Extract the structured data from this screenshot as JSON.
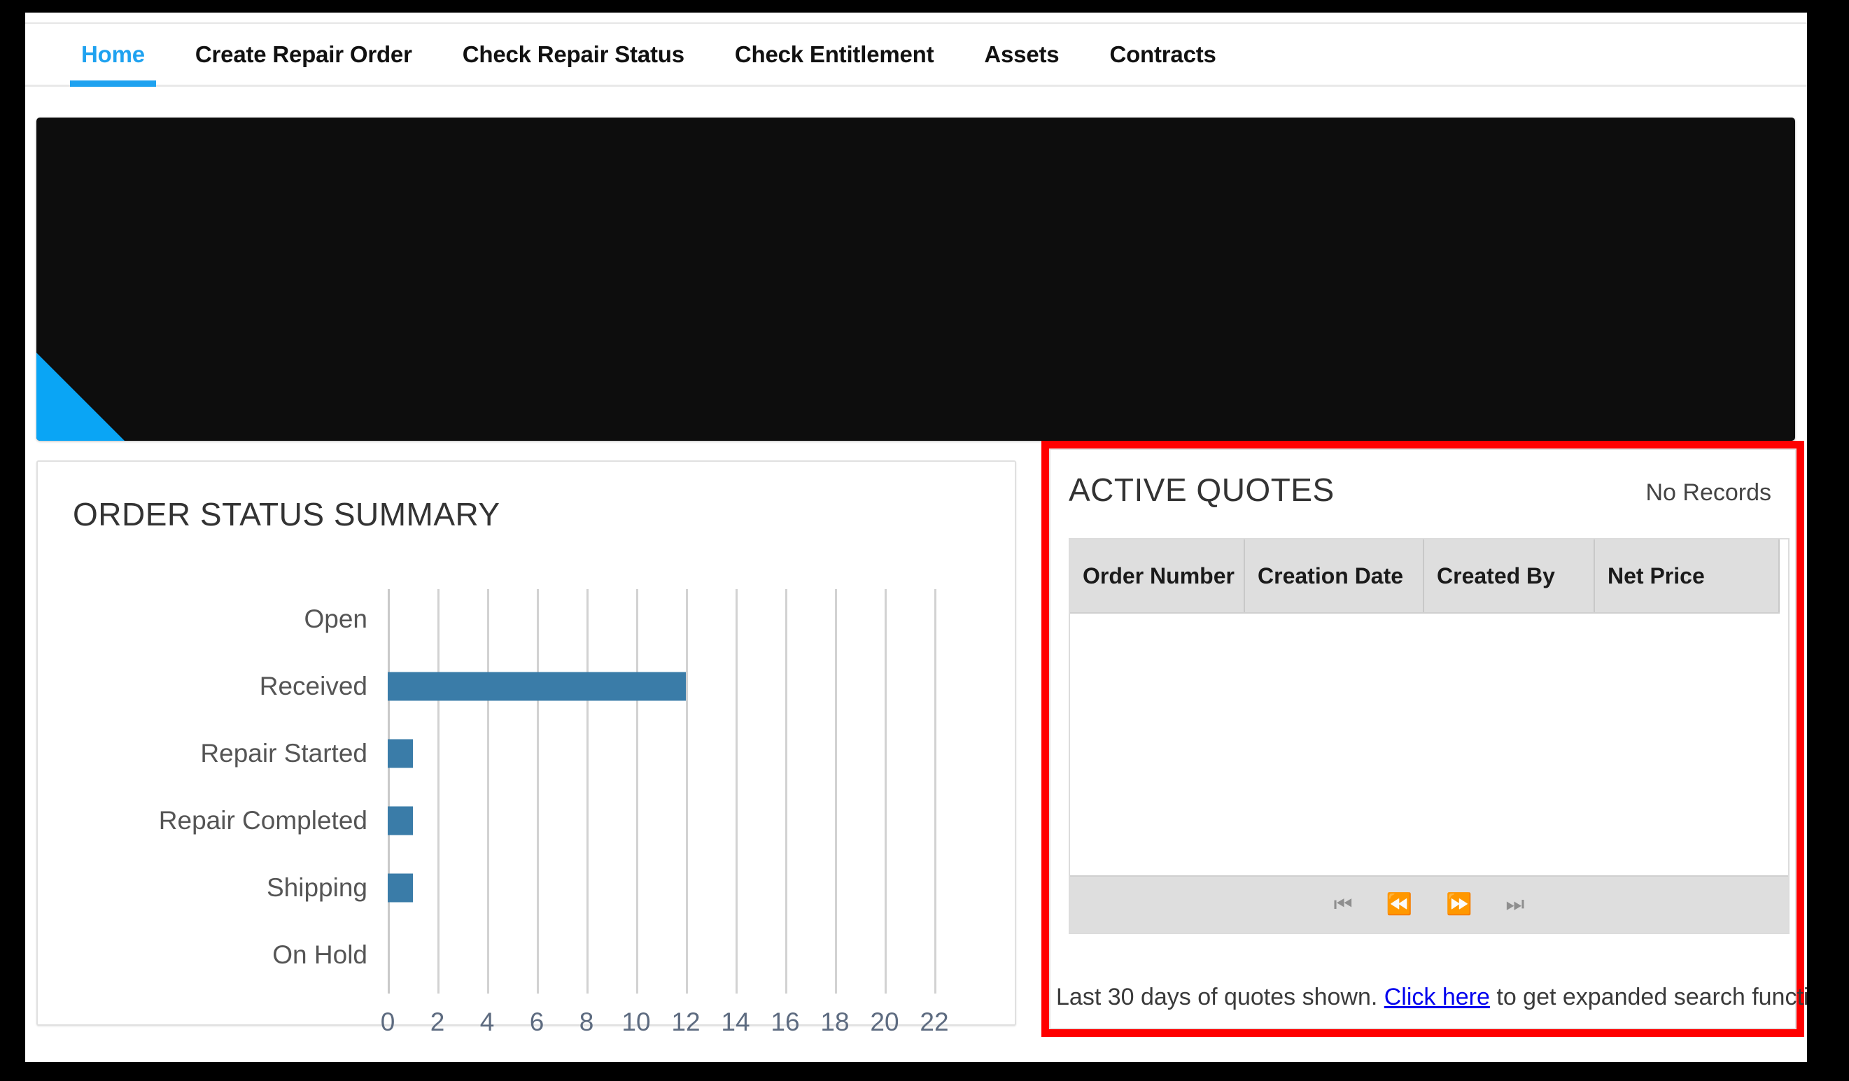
{
  "nav": {
    "items": [
      {
        "label": "Home",
        "active": true
      },
      {
        "label": "Create Repair Order",
        "active": false
      },
      {
        "label": "Check Repair Status",
        "active": false
      },
      {
        "label": "Check Entitlement",
        "active": false
      },
      {
        "label": "Assets",
        "active": false
      },
      {
        "label": "Contracts",
        "active": false
      }
    ]
  },
  "banner": {
    "background_color": "#0d0d0d",
    "accent_color": "#0aa5f5"
  },
  "order_status": {
    "title": "ORDER STATUS SUMMARY"
  },
  "chart_data": {
    "type": "bar",
    "orientation": "horizontal",
    "title": "ORDER STATUS SUMMARY",
    "categories": [
      "Open",
      "Received",
      "Repair Started",
      "Repair Completed",
      "Shipping",
      "On Hold"
    ],
    "values": [
      0,
      12,
      1,
      1,
      1,
      0
    ],
    "xlabel": "",
    "ylabel": "",
    "xlim": [
      0,
      22
    ],
    "xticks": [
      0,
      2,
      4,
      6,
      8,
      10,
      12,
      14,
      16,
      18,
      20,
      22
    ],
    "xtick_labels": [
      "0",
      "2",
      "4",
      "6",
      "8",
      "10",
      "12",
      "14",
      "16",
      "18",
      "20",
      "22"
    ],
    "grid": true,
    "grid_axis": "x",
    "legend": false,
    "bar_color": "#3a7ca8"
  },
  "active_quotes": {
    "title": "ACTIVE QUOTES",
    "status": "No Records",
    "columns": [
      "Order Number",
      "Creation Date",
      "Created By",
      "Net Price"
    ],
    "rows": [],
    "pagination": {
      "first": "⏮",
      "previous": "⏪",
      "next": "⏩",
      "last": "⏭"
    },
    "note_prefix": "Last 30 days of quotes shown. ",
    "note_link": "Click here",
    "note_suffix": " to get expanded search function.",
    "highlight_color": "#ff0000"
  }
}
